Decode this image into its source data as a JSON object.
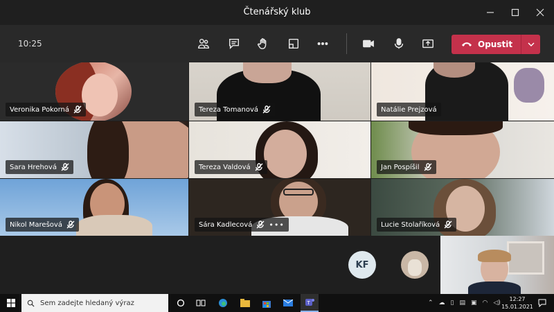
{
  "window": {
    "title": "Čtenářský klub"
  },
  "meeting": {
    "time": "10:25",
    "leave_label": "Opustit"
  },
  "participants": [
    {
      "name": "Veronika Pokorná"
    },
    {
      "name": "Tereza Tomanová"
    },
    {
      "name": "Natálie Prejzová"
    },
    {
      "name": "Sara Hrehová"
    },
    {
      "name": "Tereza Valdová"
    },
    {
      "name": "Jan Pospíšil"
    },
    {
      "name": "Nikol Marešová"
    },
    {
      "name": "Sára Kadlecová",
      "more": "•••"
    },
    {
      "name": "Lucie Stolaříková"
    }
  ],
  "avatars": [
    {
      "initials": "KF"
    }
  ],
  "taskbar": {
    "search_placeholder": "Sem zadejte hledaný výraz",
    "time": "12:27",
    "date": "15.01.2021"
  },
  "colors": {
    "leave": "#c4314b",
    "toolbar": "#292929",
    "background": "#1f1f1f"
  },
  "icons": [
    "participants-icon",
    "chat-icon",
    "raise-hand-icon",
    "rooms-icon",
    "more-icon",
    "camera-icon",
    "mic-icon",
    "share-icon",
    "phone-icon",
    "chevron-down-icon",
    "mic-off-icon",
    "windows-icon",
    "search-icon"
  ]
}
